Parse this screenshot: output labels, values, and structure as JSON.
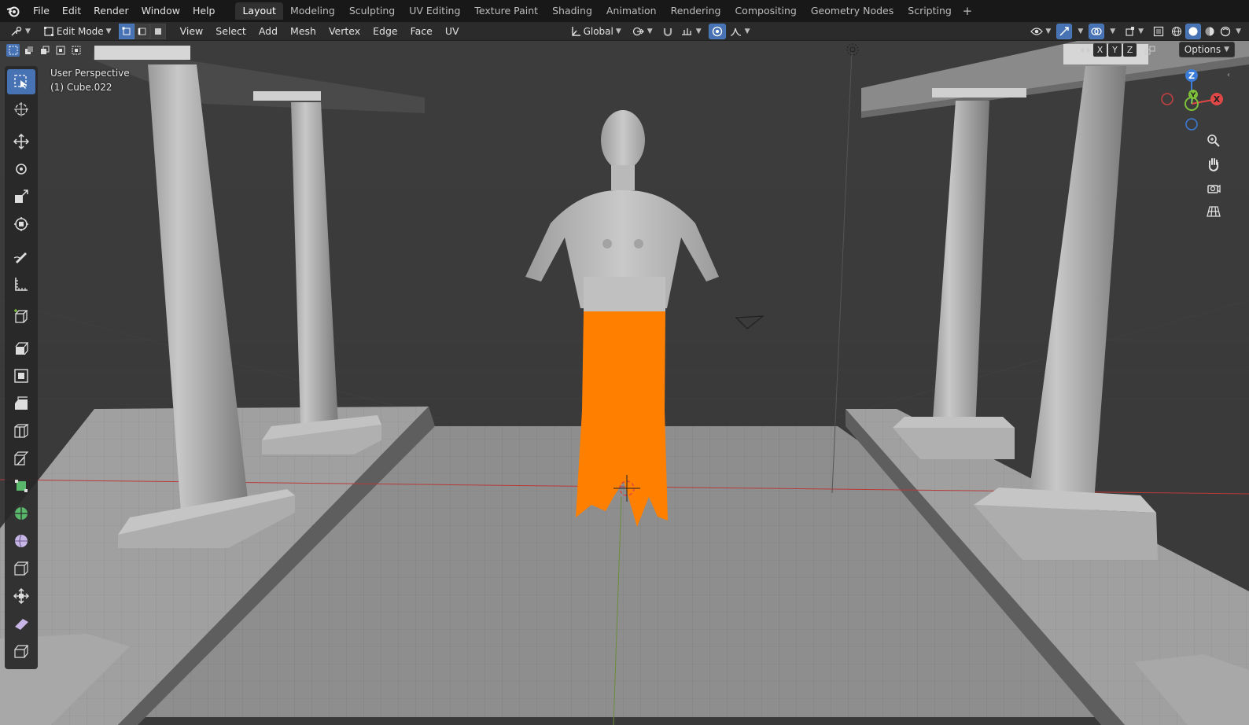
{
  "menu": {
    "items": [
      "File",
      "Edit",
      "Render",
      "Window",
      "Help"
    ]
  },
  "workspaces": {
    "tabs": [
      "Layout",
      "Modeling",
      "Sculpting",
      "UV Editing",
      "Texture Paint",
      "Shading",
      "Animation",
      "Rendering",
      "Compositing",
      "Geometry Nodes",
      "Scripting"
    ],
    "active": "Layout",
    "add_symbol": "+"
  },
  "header": {
    "mode": "Edit Mode",
    "menus": [
      "View",
      "Select",
      "Add",
      "Mesh",
      "Vertex",
      "Edge",
      "Face",
      "UV"
    ],
    "transform_orientation": "Global",
    "options_label": "Options"
  },
  "viewport": {
    "perspective_label": "User Perspective",
    "object_label": "(1) Cube.022",
    "axis_toggles": [
      "X",
      "Y",
      "Z"
    ],
    "gizmo_axes": {
      "z": "Z",
      "y": "Y",
      "x": "X"
    },
    "colors": {
      "selection": "#ff7f00",
      "x_axis": "#e04848",
      "y_axis": "#7fc03a",
      "z_axis": "#3b7cd8",
      "accent": "#4772b3"
    }
  },
  "toolbar": {
    "tools": [
      "select-box",
      "cursor",
      "move",
      "rotate",
      "scale",
      "transform",
      "annotate",
      "measure",
      "add-cube",
      "extrude-region",
      "inset-faces",
      "bevel",
      "loop-cut",
      "knife",
      "poly-build",
      "spin",
      "smooth",
      "edge-slide",
      "shrink-fatten",
      "shear",
      "rip-region"
    ],
    "active": "select-box"
  }
}
